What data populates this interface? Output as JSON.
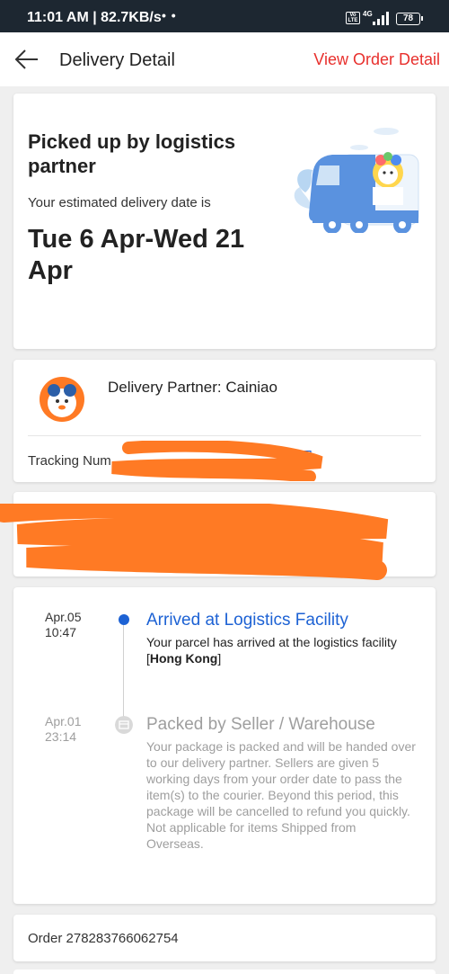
{
  "status_bar": {
    "time": "11:01 AM | 82.7KB/s",
    "dots": "• •",
    "volte": "VoLTE",
    "network": "4G",
    "battery": "78"
  },
  "header": {
    "title": "Delivery Detail",
    "action": "View Order Detail",
    "accent_color": "#e8302d"
  },
  "status_card": {
    "title": "Picked up by logistics partner",
    "eta_label": "Your estimated delivery date is",
    "eta_dates": "Tue 6 Apr-Wed 21 Apr"
  },
  "partner_card": {
    "partner_label": "Delivery Partner: Cainiao",
    "tracking_label": "Tracking Num"
  },
  "address_card": {
    "text": "(redacted)"
  },
  "timeline": [
    {
      "date": "Apr.05",
      "time": "10:47",
      "title": "Arrived at Logistics Facility",
      "desc_prefix": "Your parcel has arrived at the logistics facility [",
      "desc_bold": "Hong Kong",
      "desc_suffix": "]",
      "active": true,
      "color": "#1d62d4"
    },
    {
      "date": "Apr.01",
      "time": "23:14",
      "title": "Packed by Seller / Warehouse",
      "desc": "Your package is packed and will be handed over to our delivery partner. Sellers are given 5 working days from your order date to pass the item(s) to the courier. Beyond this period, this package will be cancelled to refund you quickly. Not applicable for items Shipped from Overseas.",
      "active": false,
      "color": "#9e9e9e"
    }
  ],
  "order": {
    "label": "Order 278283766062754"
  },
  "redaction_color": "#ff7a24"
}
